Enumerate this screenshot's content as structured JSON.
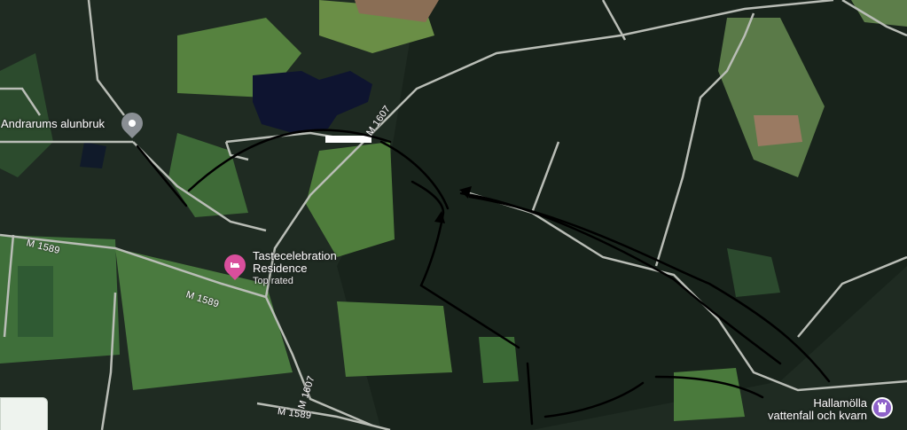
{
  "map": {
    "view": "satellite",
    "colors": {
      "forest": "#1f2b22",
      "field": "#4d7a3c",
      "road": "#b9bdb6",
      "lake": "#0e1430",
      "annotation": "#000000",
      "pin_gray": "#8a8f94",
      "pin_pink": "#d94f9c",
      "pin_purple": "#8e62c9"
    },
    "places": [
      {
        "name": "Andrarums alunbruk",
        "icon": "location-pin-icon"
      },
      {
        "name": "Tastecelebration",
        "name_line2": "Residence",
        "subtitle": "Top rated",
        "icon": "hotel-bed-icon"
      },
      {
        "name": "Hallamölla",
        "name_line2": "vattenfall och kvarn",
        "icon": "landmark-tower-icon"
      }
    ],
    "roads": [
      {
        "label": "M 1607"
      },
      {
        "label": "M 1589"
      },
      {
        "label": "M 1589"
      },
      {
        "label": "M 1607"
      },
      {
        "label": "M 1589"
      }
    ]
  }
}
